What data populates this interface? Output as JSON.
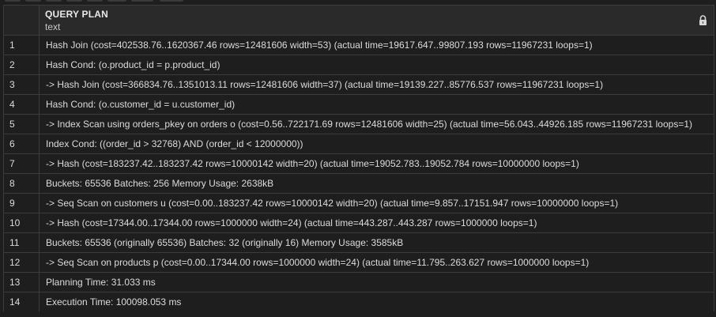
{
  "column": {
    "name": "QUERY PLAN",
    "type": "text",
    "locked_icon": "lock-icon"
  },
  "rows": [
    {
      "num": "1",
      "text": "Hash Join (cost=402538.76..1620367.46 rows=12481606 width=53) (actual time=19617.647..99807.193 rows=11967231 loops=1)"
    },
    {
      "num": "2",
      "text": "Hash Cond: (o.product_id = p.product_id)"
    },
    {
      "num": "3",
      "text": "-> Hash Join (cost=366834.76..1351013.11 rows=12481606 width=37) (actual time=19139.227..85776.537 rows=11967231 loops=1)"
    },
    {
      "num": "4",
      "text": "Hash Cond: (o.customer_id = u.customer_id)"
    },
    {
      "num": "5",
      "text": "-> Index Scan using orders_pkey on orders o (cost=0.56..722171.69 rows=12481606 width=25) (actual time=56.043..44926.185 rows=11967231 loops=1)"
    },
    {
      "num": "6",
      "text": "Index Cond: ((order_id > 32768) AND (order_id < 12000000))"
    },
    {
      "num": "7",
      "text": "-> Hash (cost=183237.42..183237.42 rows=10000142 width=20) (actual time=19052.783..19052.784 rows=10000000 loops=1)"
    },
    {
      "num": "8",
      "text": "Buckets: 65536 Batches: 256 Memory Usage: 2638kB"
    },
    {
      "num": "9",
      "text": "-> Seq Scan on customers u (cost=0.00..183237.42 rows=10000142 width=20) (actual time=9.857..17151.947 rows=10000000 loops=1)"
    },
    {
      "num": "10",
      "text": "-> Hash (cost=17344.00..17344.00 rows=1000000 width=24) (actual time=443.287..443.287 rows=1000000 loops=1)"
    },
    {
      "num": "11",
      "text": "Buckets: 65536 (originally 65536) Batches: 32 (originally 16) Memory Usage: 3585kB"
    },
    {
      "num": "12",
      "text": "-> Seq Scan on products p (cost=0.00..17344.00 rows=1000000 width=24) (actual time=11.795..263.627 rows=1000000 loops=1)"
    },
    {
      "num": "13",
      "text": "Planning Time: 31.033 ms"
    },
    {
      "num": "14",
      "text": "Execution Time: 100098.053 ms"
    }
  ]
}
